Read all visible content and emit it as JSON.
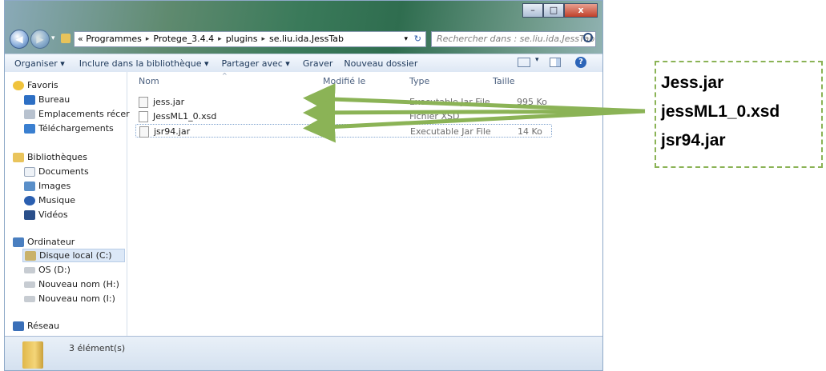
{
  "window": {
    "caption_buttons": [
      "–",
      "□",
      "x"
    ]
  },
  "navbar": {
    "back_symbol": "◀",
    "forward_symbol": "▶",
    "breadcrumb": [
      "« Programmes",
      "Protege_3.4.4",
      "plugins",
      "se.liu.ida.JessTab"
    ],
    "separator": "▸",
    "search_placeholder": "Rechercher dans : se.liu.ida.JessTab"
  },
  "toolbar": {
    "organize": "Organiser ▾",
    "include": "Inclure dans la bibliothèque ▾",
    "share": "Partager avec ▾",
    "burn": "Graver",
    "new_folder": "Nouveau dossier"
  },
  "sidebar": {
    "favorites": "Favoris",
    "desktop": "Bureau",
    "recent": "Emplacements récer",
    "downloads": "Téléchargements",
    "libraries": "Bibliothèques",
    "documents": "Documents",
    "images": "Images",
    "music": "Musique",
    "videos": "Vidéos",
    "computer": "Ordinateur",
    "drive_c": "Disque local (C:)",
    "drive_d": "OS (D:)",
    "drive_h": "Nouveau nom (H:)",
    "drive_i": "Nouveau nom (I:)",
    "network": "Réseau"
  },
  "columns": {
    "name": "Nom",
    "modified": "Modifié le",
    "type": "Type",
    "size": "Taille"
  },
  "files": [
    {
      "name": "jess.jar",
      "modified": "",
      "type": "Executable Jar File",
      "size": "995 Ko"
    },
    {
      "name": "JessML1_0.xsd",
      "modified": "",
      "type": "Fichier XSD",
      "size": ""
    },
    {
      "name": "jsr94.jar",
      "modified": "",
      "type": "Executable Jar File",
      "size": "14 Ko"
    }
  ],
  "status": {
    "count": "3 élément(s)"
  },
  "callout": {
    "lines": [
      "Jess.jar",
      "jessML1_0.xsd",
      "jsr94.jar"
    ]
  },
  "colors": {
    "arrow": "#8bb356",
    "accent": "#1e395b"
  }
}
